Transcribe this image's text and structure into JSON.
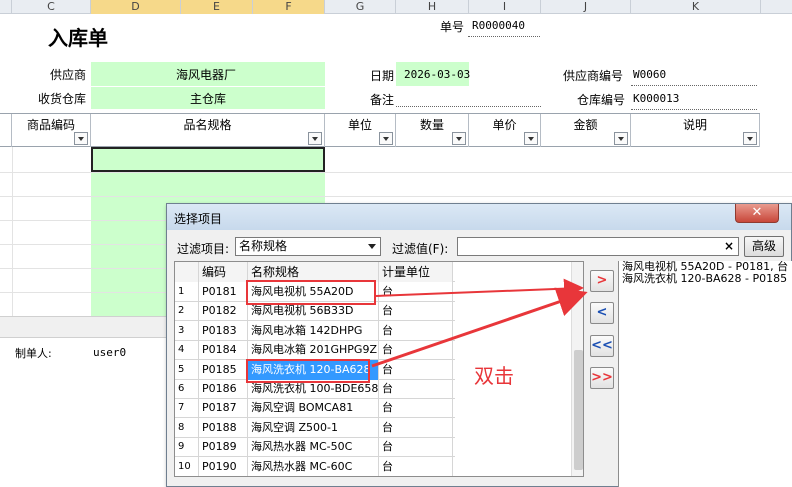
{
  "columns": [
    "C",
    "D",
    "E",
    "F",
    "G",
    "H",
    "I",
    "J",
    "K"
  ],
  "form": {
    "title": "入库单",
    "order_no_label": "单号",
    "order_no": "R0000040",
    "supplier_label": "供应商",
    "supplier": "海风电器厂",
    "date_label": "日期",
    "date": "2026-03-03",
    "supplier_code_label": "供应商编号",
    "supplier_code": "W0060",
    "warehouse_label": "收货仓库",
    "warehouse": "主仓库",
    "remark_label": "备注",
    "warehouse_code_label": "仓库编号",
    "warehouse_code": "K000013",
    "maker_label": "制单人:",
    "maker": "user0"
  },
  "table_headers": [
    "商品编码",
    "品名规格",
    "单位",
    "数量",
    "单价",
    "金额",
    "说明"
  ],
  "dialog": {
    "title": "选择项目",
    "filter_item_label": "过滤项目:",
    "filter_item_value": "名称规格",
    "filter_value_label": "过滤值(F):",
    "clear": "×",
    "advanced": "高级",
    "grid_headers": [
      "编码",
      "名称规格",
      "计量单位"
    ],
    "rows": [
      {
        "n": "1",
        "code": "P0181",
        "name": "海风电视机 55A20D",
        "unit": "台"
      },
      {
        "n": "2",
        "code": "P0182",
        "name": "海风电视机 56B33D",
        "unit": "台"
      },
      {
        "n": "3",
        "code": "P0183",
        "name": "海风电冰箱 142DHPG",
        "unit": "台"
      },
      {
        "n": "4",
        "code": "P0184",
        "name": "海风电冰箱 201GHPG9Z",
        "unit": "台"
      },
      {
        "n": "5",
        "code": "P0185",
        "name": "海风洗衣机 120-BA628",
        "unit": "台"
      },
      {
        "n": "6",
        "code": "P0186",
        "name": "海风洗衣机 100-BDE658",
        "unit": "台"
      },
      {
        "n": "7",
        "code": "P0187",
        "name": "海风空调 BOMCA81",
        "unit": "台"
      },
      {
        "n": "8",
        "code": "P0188",
        "name": "海风空调 Z500-1",
        "unit": "台"
      },
      {
        "n": "9",
        "code": "P0189",
        "name": "海风热水器 MC-50C",
        "unit": "台"
      },
      {
        "n": "10",
        "code": "P0190",
        "name": "海风热水器 MC-60C",
        "unit": "台"
      }
    ],
    "selected_row": "5",
    "buttons": [
      ">",
      "<",
      "<<",
      ">>"
    ],
    "selected_items": [
      "海风电视机 55A20D - P0181, 台",
      "海风洗衣机 120-BA628 - P0185"
    ]
  },
  "annotation": "双击",
  "colors": {
    "accent_red": "#e8363a",
    "green_cell": "#ccffcc",
    "selection_blue": "#3399ff"
  }
}
